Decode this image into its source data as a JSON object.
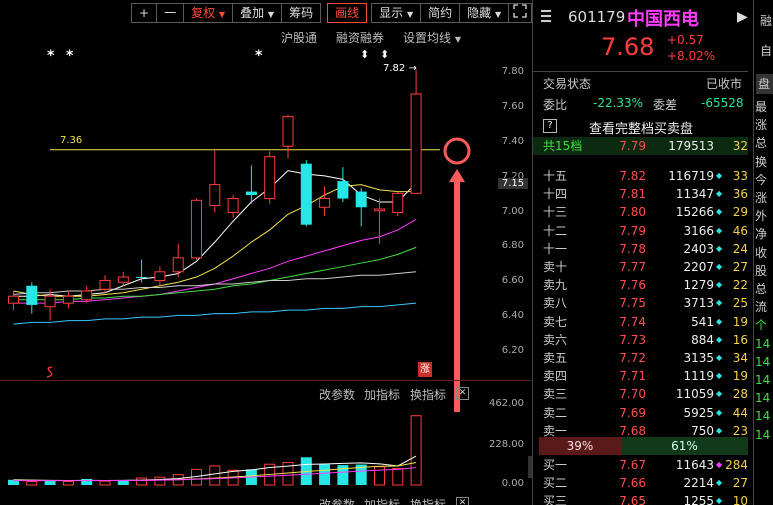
{
  "toolbar": {
    "plus": "+",
    "minus": "一",
    "fuquan": "复权",
    "diejia": "叠加",
    "chouma": "筹码",
    "huaxian": "画线",
    "xianshi": "显示",
    "jianjie": "简约",
    "yincang": "隐藏",
    "expand_icon": "expand-icon"
  },
  "subbar": {
    "hgt": "沪股通",
    "rzrq": "融资融券",
    "settings": "设置均线"
  },
  "stars": [
    "*",
    "*",
    "*"
  ],
  "arrows": [
    "⬍",
    "⬍"
  ],
  "chart_data": {
    "type": "candlestick",
    "ylim": [
      6.1,
      7.9
    ],
    "y_ticks": [
      "7.80",
      "7.60",
      "7.40",
      "7.20",
      "7.00",
      "6.80",
      "6.60",
      "6.40",
      "6.20"
    ],
    "current_price_label": "7.15",
    "high_annotation": "7.82",
    "ref_line_label": "7.36",
    "limit_up_badge": "涨",
    "candles": [
      {
        "o": 6.48,
        "c": 6.52,
        "h": 6.55,
        "l": 6.44,
        "up": true
      },
      {
        "o": 6.58,
        "c": 6.47,
        "h": 6.6,
        "l": 6.42,
        "up": false
      },
      {
        "o": 6.46,
        "c": 6.52,
        "h": 6.56,
        "l": 6.38,
        "up": true
      },
      {
        "o": 6.48,
        "c": 6.52,
        "h": 6.55,
        "l": 6.45,
        "up": true
      },
      {
        "o": 6.5,
        "c": 6.55,
        "h": 6.58,
        "l": 6.48,
        "up": true
      },
      {
        "o": 6.56,
        "c": 6.61,
        "h": 6.64,
        "l": 6.54,
        "up": true
      },
      {
        "o": 6.6,
        "c": 6.63,
        "h": 6.66,
        "l": 6.58,
        "up": true
      },
      {
        "o": 6.63,
        "c": 6.63,
        "h": 6.73,
        "l": 6.6,
        "up": false
      },
      {
        "o": 6.61,
        "c": 6.66,
        "h": 6.69,
        "l": 6.58,
        "up": true
      },
      {
        "o": 6.66,
        "c": 6.74,
        "h": 6.82,
        "l": 6.63,
        "up": true
      },
      {
        "o": 6.74,
        "c": 7.07,
        "h": 7.08,
        "l": 6.73,
        "up": true
      },
      {
        "o": 7.04,
        "c": 7.16,
        "h": 7.36,
        "l": 7.0,
        "up": true
      },
      {
        "o": 7.0,
        "c": 7.08,
        "h": 7.1,
        "l": 6.97,
        "up": true
      },
      {
        "o": 7.12,
        "c": 7.1,
        "h": 7.27,
        "l": 7.05,
        "up": false
      },
      {
        "o": 7.08,
        "c": 7.32,
        "h": 7.35,
        "l": 7.05,
        "up": true
      },
      {
        "o": 7.38,
        "c": 7.55,
        "h": 7.56,
        "l": 7.31,
        "up": true
      },
      {
        "o": 7.28,
        "c": 6.93,
        "h": 7.3,
        "l": 6.92,
        "up": false
      },
      {
        "o": 7.03,
        "c": 7.08,
        "h": 7.15,
        "l": 6.98,
        "up": true
      },
      {
        "o": 7.18,
        "c": 7.08,
        "h": 7.26,
        "l": 7.06,
        "up": false
      },
      {
        "o": 7.12,
        "c": 7.03,
        "h": 7.14,
        "l": 6.92,
        "up": false
      },
      {
        "o": 7.02,
        "c": 7.01,
        "h": 7.08,
        "l": 6.82,
        "up": true
      },
      {
        "o": 7.0,
        "c": 7.11,
        "h": 7.12,
        "l": 6.98,
        "up": true
      },
      {
        "o": 7.11,
        "c": 7.68,
        "h": 7.82,
        "l": 7.11,
        "up": true
      }
    ],
    "ma_series": [
      {
        "name": "MA5",
        "color": "#ffffff",
        "values": [
          6.52,
          6.52,
          6.53,
          6.52,
          6.53,
          6.54,
          6.58,
          6.62,
          6.63,
          6.65,
          6.72,
          6.83,
          6.95,
          7.06,
          7.14,
          7.24,
          7.22,
          7.21,
          7.19,
          7.1,
          7.06,
          7.06,
          7.17
        ]
      },
      {
        "name": "MA10",
        "color": "#f2e24a",
        "values": [
          6.55,
          6.53,
          6.52,
          6.52,
          6.52,
          6.53,
          6.54,
          6.56,
          6.58,
          6.6,
          6.63,
          6.68,
          6.75,
          6.83,
          6.9,
          6.99,
          7.04,
          7.1,
          7.15,
          7.16,
          7.13,
          7.12,
          7.12
        ]
      },
      {
        "name": "MA20",
        "color": "#ff3cff",
        "values": [
          6.48,
          6.48,
          6.48,
          6.49,
          6.49,
          6.5,
          6.51,
          6.52,
          6.53,
          6.55,
          6.57,
          6.59,
          6.62,
          6.65,
          6.68,
          6.72,
          6.75,
          6.78,
          6.81,
          6.84,
          6.86,
          6.9,
          6.96
        ]
      },
      {
        "name": "MA30",
        "color": "#40e040",
        "values": [
          6.5,
          6.5,
          6.5,
          6.5,
          6.51,
          6.51,
          6.52,
          6.52,
          6.53,
          6.54,
          6.55,
          6.56,
          6.58,
          6.59,
          6.61,
          6.63,
          6.65,
          6.67,
          6.69,
          6.71,
          6.73,
          6.76,
          6.8
        ]
      },
      {
        "name": "MA60",
        "color": "#cccccc",
        "values": [
          6.53,
          6.54,
          6.54,
          6.55,
          6.55,
          6.56,
          6.56,
          6.57,
          6.57,
          6.58,
          6.58,
          6.59,
          6.59,
          6.6,
          6.61,
          6.61,
          6.62,
          6.62,
          6.63,
          6.64,
          6.64,
          6.65,
          6.66
        ]
      },
      {
        "name": "MA120",
        "color": "#3bc6ff",
        "values": [
          6.36,
          6.37,
          6.37,
          6.38,
          6.38,
          6.39,
          6.39,
          6.4,
          6.4,
          6.41,
          6.41,
          6.42,
          6.42,
          6.43,
          6.43,
          6.44,
          6.44,
          6.45,
          6.45,
          6.46,
          6.46,
          6.47,
          6.48
        ]
      }
    ],
    "volume": {
      "ylim": [
        0,
        462
      ],
      "y_ticks": [
        "462.00",
        "228.00",
        "0.00"
      ],
      "bars": [
        {
          "v": 30,
          "up": false
        },
        {
          "v": 20,
          "up": true
        },
        {
          "v": 28,
          "up": false
        },
        {
          "v": 20,
          "up": true
        },
        {
          "v": 35,
          "up": false
        },
        {
          "v": 22,
          "up": true
        },
        {
          "v": 28,
          "up": false
        },
        {
          "v": 40,
          "up": true
        },
        {
          "v": 45,
          "up": true
        },
        {
          "v": 60,
          "up": true
        },
        {
          "v": 90,
          "up": true
        },
        {
          "v": 110,
          "up": true
        },
        {
          "v": 85,
          "up": true
        },
        {
          "v": 90,
          "up": false
        },
        {
          "v": 120,
          "up": true
        },
        {
          "v": 130,
          "up": true
        },
        {
          "v": 160,
          "up": false
        },
        {
          "v": 120,
          "up": false
        },
        {
          "v": 115,
          "up": false
        },
        {
          "v": 118,
          "up": false
        },
        {
          "v": 105,
          "up": true
        },
        {
          "v": 95,
          "up": true
        },
        {
          "v": 400,
          "up": true
        }
      ],
      "ma_lines": [
        {
          "color": "#ffffff",
          "values": [
            30,
            28,
            27,
            26,
            27,
            26,
            27,
            28,
            32,
            37,
            49,
            64,
            79,
            87,
            101,
            109,
            119,
            121,
            125,
            128,
            122,
            110,
            167
          ]
        },
        {
          "color": "#f2e24a",
          "values": [
            28,
            27,
            26,
            26,
            26,
            26,
            26,
            27,
            29,
            31,
            35,
            40,
            46,
            53,
            61,
            69,
            78,
            85,
            94,
            102,
            108,
            110,
            130
          ]
        },
        {
          "color": "#ff3cff",
          "values": [
            25,
            25,
            25,
            25,
            25,
            26,
            26,
            27,
            28,
            30,
            33,
            37,
            41,
            46,
            51,
            56,
            62,
            68,
            74,
            80,
            86,
            90,
            100
          ]
        }
      ]
    }
  },
  "lower_toolbar": {
    "gaicanshu": "改参数",
    "jiazhibiao": "加指标",
    "huanzhibiao": "换指标",
    "close": "✕"
  },
  "stock": {
    "code": "601179",
    "name": "中国西电",
    "price": "7.68",
    "change": "+0.57",
    "change_pct": "+8.02%",
    "status_label": "交易状态",
    "status_value": "已收市",
    "weibi_label": "委比",
    "weibi_value": "-22.33%",
    "weicha_label": "委差",
    "weicha_value": "-65528",
    "help": "?",
    "full_book": "查看完整档买卖盘"
  },
  "book_total": {
    "label": "共15档",
    "price": "7.79",
    "vol": "179513",
    "count": "32"
  },
  "asks": [
    {
      "label": "十五",
      "price": "7.82",
      "vol": "116719",
      "dot": "◆",
      "count": "33"
    },
    {
      "label": "十四",
      "price": "7.81",
      "vol": "11347",
      "dot": "◆",
      "count": "36"
    },
    {
      "label": "十三",
      "price": "7.80",
      "vol": "15266",
      "dot": "◆",
      "count": "29"
    },
    {
      "label": "十二",
      "price": "7.79",
      "vol": "3166",
      "dot": "◆",
      "count": "46"
    },
    {
      "label": "十一",
      "price": "7.78",
      "vol": "2403",
      "dot": "◆",
      "count": "24"
    },
    {
      "label": "卖十",
      "price": "7.77",
      "vol": "2207",
      "dot": "◆",
      "count": "27"
    },
    {
      "label": "卖九",
      "price": "7.76",
      "vol": "1279",
      "dot": "◆",
      "count": "22"
    },
    {
      "label": "卖八",
      "price": "7.75",
      "vol": "3713",
      "dot": "◆",
      "count": "25"
    },
    {
      "label": "卖七",
      "price": "7.74",
      "vol": "541",
      "dot": "◆",
      "count": "19"
    },
    {
      "label": "卖六",
      "price": "7.73",
      "vol": "884",
      "dot": "◆",
      "count": "16"
    },
    {
      "label": "卖五",
      "price": "7.72",
      "vol": "3135",
      "dot": "◆",
      "count": "34"
    },
    {
      "label": "卖四",
      "price": "7.71",
      "vol": "1119",
      "dot": "◆",
      "count": "19"
    },
    {
      "label": "卖三",
      "price": "7.70",
      "vol": "11059",
      "dot": "◆",
      "count": "28"
    },
    {
      "label": "卖二",
      "price": "7.69",
      "vol": "5925",
      "dot": "◆",
      "count": "44"
    },
    {
      "label": "卖一",
      "price": "7.68",
      "vol": "750",
      "dot": "◆",
      "count": "23"
    }
  ],
  "ratio": {
    "sell": "39%",
    "buy": "61%"
  },
  "bids": [
    {
      "label": "买一",
      "price": "7.67",
      "vol": "11643",
      "dot": "◆",
      "count": "284"
    },
    {
      "label": "买二",
      "price": "7.66",
      "vol": "2214",
      "dot": "◆",
      "count": "27"
    },
    {
      "label": "买三",
      "price": "7.65",
      "vol": "1255",
      "dot": "◆",
      "count": "10"
    }
  ],
  "side_tab": {
    "label": "盘"
  },
  "side_top": [
    "融",
    "自"
  ],
  "side_labels": [
    "最",
    "涨",
    "总",
    "换",
    "今",
    "涨",
    "外",
    "净",
    "收",
    "股",
    "总",
    "流",
    "",
    "",
    "",
    "",
    "",
    "",
    ""
  ],
  "side_values": [
    "",
    "",
    "",
    "",
    "",
    "",
    "",
    "",
    "",
    "",
    "",
    "",
    "个",
    "14",
    "14",
    "14",
    "14",
    "14",
    "14"
  ],
  "colors": {
    "up": "#ff3c3c",
    "down": "#27e6e6",
    "accent": "#ff4a3a",
    "name": "#ff3cff"
  }
}
